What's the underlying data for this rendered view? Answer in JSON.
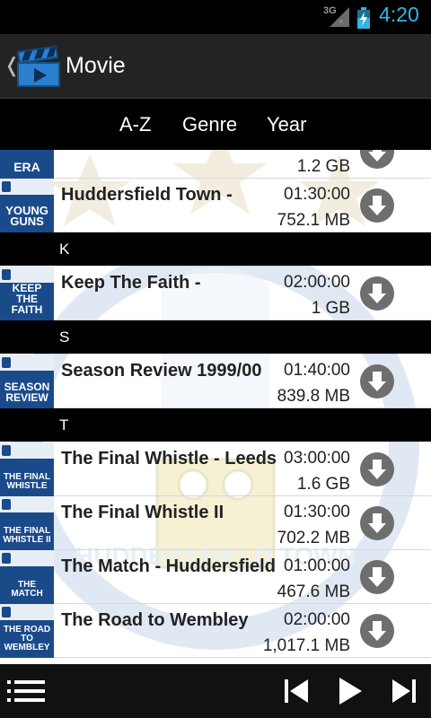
{
  "status_bar": {
    "network": "3G",
    "time": "4:20"
  },
  "action_bar": {
    "title": "Movie",
    "icons": [
      "back-chevron-icon",
      "clapperboard-icon"
    ]
  },
  "tabs": [
    {
      "label": "A-Z"
    },
    {
      "label": "Genre"
    },
    {
      "label": "Year"
    }
  ],
  "sections": [
    {
      "label": "K"
    },
    {
      "label": "S"
    },
    {
      "label": "T"
    }
  ],
  "rows": [
    {
      "thumb_text": "ERA",
      "title": "",
      "duration": "",
      "size": "1.2 GB"
    },
    {
      "thumb_text": "YOUNG GUNS",
      "title": "Huddersfield Town -",
      "duration": "01:30:00",
      "size": "752.1 MB"
    },
    {
      "thumb_text": "KEEP THE FAITH",
      "title": "Keep The Faith -",
      "duration": "02:00:00",
      "size": "1 GB"
    },
    {
      "thumb_text": "SEASON REVIEW",
      "title": "Season Review 1999/00",
      "duration": "01:40:00",
      "size": "839.8 MB"
    },
    {
      "thumb_text": "THE FINAL WHISTLE",
      "title": "The Final Whistle - Leeds",
      "duration": "03:00:00",
      "size": "1.6 GB"
    },
    {
      "thumb_text": "THE FINAL WHISTLE II",
      "title": "The Final Whistle II",
      "duration": "01:30:00",
      "size": "702.2 MB"
    },
    {
      "thumb_text": "THE MATCH",
      "title": "The Match - Huddersfield",
      "duration": "01:00:00",
      "size": "467.6 MB"
    },
    {
      "thumb_text": "THE ROAD TO WEMBLEY",
      "title": "The Road to Wembley",
      "duration": "02:00:00",
      "size": "1,017.1 MB"
    }
  ],
  "watermark_text": "HUDDERSFIELD TOWN",
  "bottom_bar": {
    "icons": [
      "list-menu-icon",
      "skip-previous-icon",
      "play-icon",
      "skip-next-icon"
    ]
  },
  "colors": {
    "accent": "#33b5e5",
    "action_bar": "#232323",
    "crest_blue": "#1a4a8a"
  }
}
